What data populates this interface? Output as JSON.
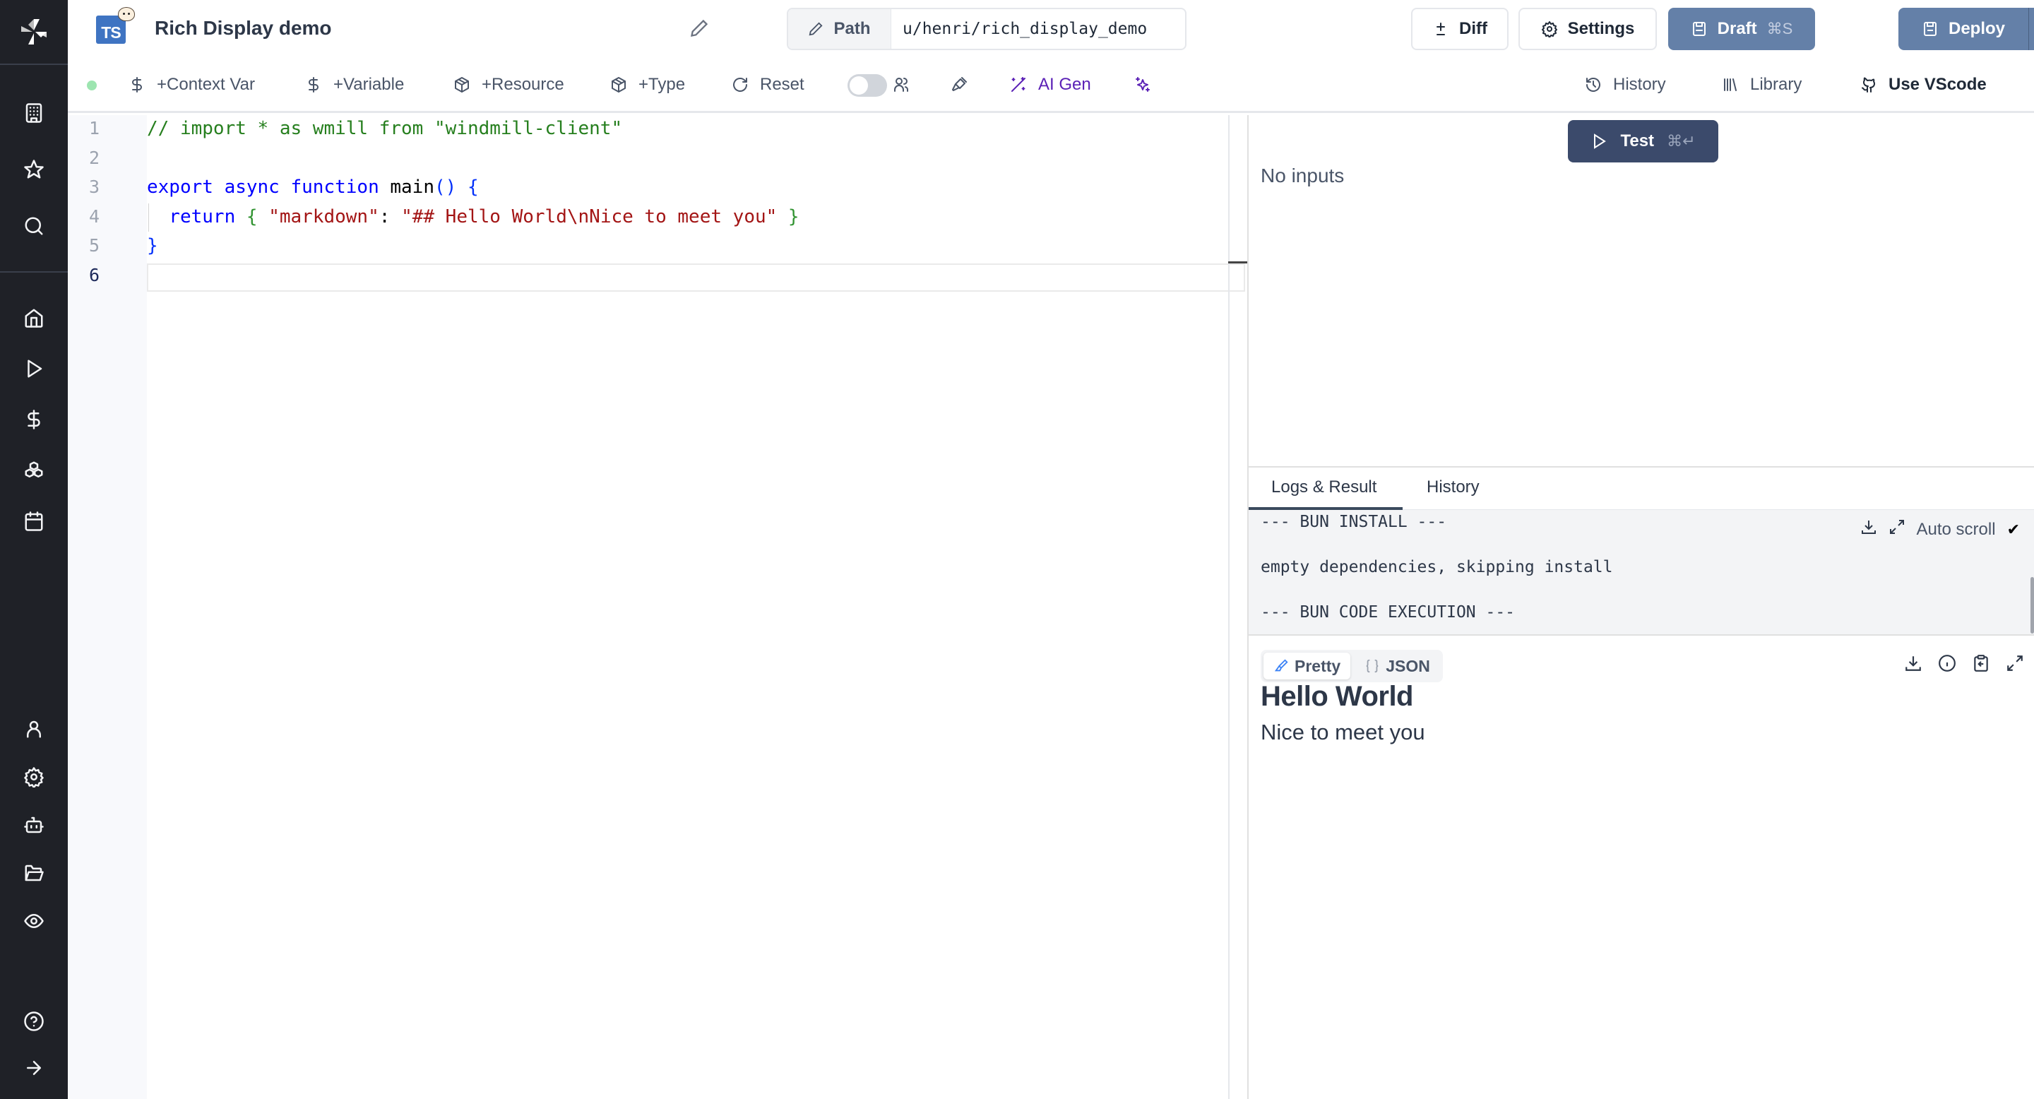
{
  "sidebar": {
    "top_items": [
      {
        "name": "workspace",
        "icon": "building-icon"
      },
      {
        "name": "favorites",
        "icon": "star-icon"
      },
      {
        "name": "search",
        "icon": "search-icon"
      }
    ],
    "main_items": [
      {
        "name": "home",
        "icon": "home-icon"
      },
      {
        "name": "runs",
        "icon": "play-icon"
      },
      {
        "name": "variables",
        "icon": "dollar-icon"
      },
      {
        "name": "resources",
        "icon": "boxes-icon"
      },
      {
        "name": "schedules",
        "icon": "calendar-icon"
      }
    ],
    "bottom_items": [
      {
        "name": "user",
        "icon": "user-icon"
      },
      {
        "name": "settings",
        "icon": "gear-icon"
      },
      {
        "name": "workers",
        "icon": "bot-icon"
      },
      {
        "name": "folders",
        "icon": "folder-open-icon"
      },
      {
        "name": "audit",
        "icon": "eye-icon"
      }
    ],
    "footer_items": [
      {
        "name": "help",
        "icon": "help-circle-icon"
      },
      {
        "name": "expand",
        "icon": "arrow-right-icon"
      }
    ]
  },
  "header": {
    "language_badge": "TS",
    "title": "Rich Display demo",
    "path_label": "Path",
    "path_value": "u/henri/rich_display_demo",
    "diff_label": "Diff",
    "settings_label": "Settings",
    "draft_label": "Draft",
    "draft_shortcut": "⌘S",
    "deploy_label": "Deploy"
  },
  "toolbar": {
    "status_color": "#9de5b0",
    "context_var": "+Context Var",
    "variable": "+Variable",
    "resource": "+Resource",
    "type": "+Type",
    "reset": "Reset",
    "multiplayer_enabled": false,
    "ai_gen": "AI Gen",
    "history": "History",
    "library": "Library",
    "use_vscode": "Use VScode"
  },
  "editor": {
    "active_line": 6,
    "lines": [
      {
        "n": "1",
        "tokens": [
          {
            "t": "com",
            "v": "// import * as wmill from \"windmill-client\""
          }
        ]
      },
      {
        "n": "2",
        "tokens": []
      },
      {
        "n": "3",
        "tokens": [
          {
            "t": "kw",
            "v": "export async function "
          },
          {
            "t": "fn",
            "v": "main"
          },
          {
            "t": "par",
            "v": "() {"
          }
        ]
      },
      {
        "n": "4",
        "tokens": [
          {
            "t": "kw",
            "v": "  return "
          },
          {
            "t": "br",
            "v": "{ "
          },
          {
            "t": "str",
            "v": "\"markdown\""
          },
          {
            "t": "fn",
            "v": ": "
          },
          {
            "t": "str",
            "v": "\"## Hello World\\nNice to meet you\""
          },
          {
            "t": "br",
            "v": " }"
          }
        ]
      },
      {
        "n": "5",
        "tokens": [
          {
            "t": "par",
            "v": "}"
          }
        ]
      },
      {
        "n": "6",
        "tokens": []
      }
    ]
  },
  "right_panel": {
    "test_label": "Test",
    "test_shortcut": "⌘↵",
    "no_inputs": "No inputs",
    "tabs": [
      {
        "label": "Logs & Result",
        "active": true
      },
      {
        "label": "History",
        "active": false
      }
    ],
    "logs": [
      "--- BUN INSTALL ---",
      "empty dependencies, skipping install",
      "--- BUN CODE EXECUTION ---"
    ],
    "auto_scroll_label": "Auto scroll",
    "auto_scroll_checked": "✔",
    "result_modes": [
      {
        "label": "Pretty",
        "active": true
      },
      {
        "label": "JSON",
        "active": false
      }
    ],
    "result": {
      "heading": "Hello World",
      "paragraph": "Nice to meet you"
    }
  }
}
